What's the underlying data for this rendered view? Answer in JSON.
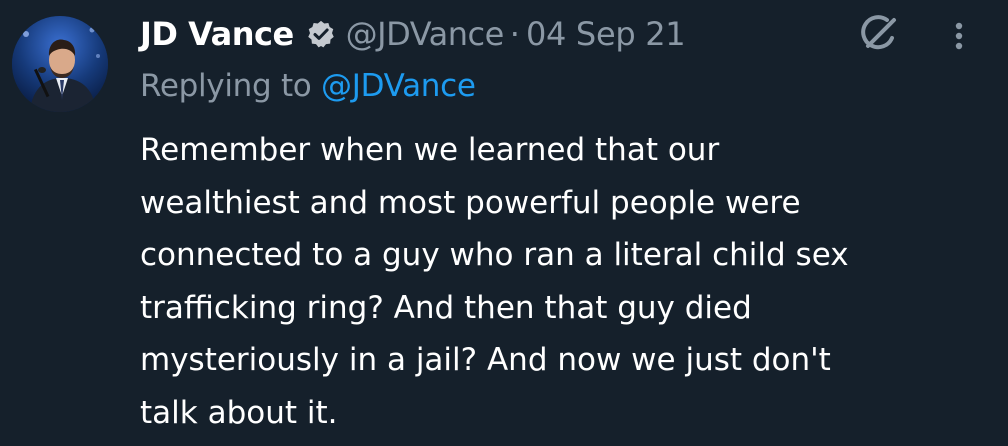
{
  "tweet": {
    "author_name": "JD Vance",
    "handle": "@JDVance",
    "separator": "·",
    "date": "04 Sep 21",
    "verified": true,
    "reply_prefix": "Replying to",
    "reply_handle": "@JDVance",
    "body_lines": [
      "Remember when we learned that our",
      "wealthiest and most powerful people were",
      "connected to a guy who ran a literal child sex",
      "trafficking ring? And then that guy died",
      "mysteriously in a jail? And now we just don't",
      "talk about it."
    ]
  },
  "icons": {
    "verified": "verified-badge-icon",
    "grok": "grok-icon",
    "more": "more-options-icon"
  },
  "colors": {
    "background": "#15202b",
    "primary_text": "#ffffff",
    "secondary_text": "#8b98a5",
    "link": "#1d9bf0"
  }
}
